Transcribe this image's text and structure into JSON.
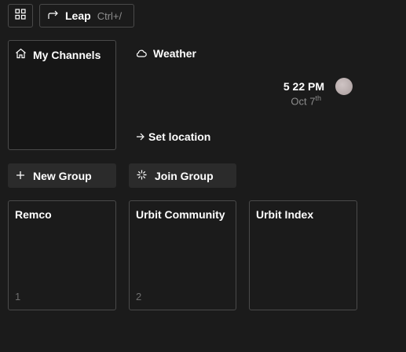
{
  "top_bar": {
    "grid_icon": "grid-icon",
    "leap": {
      "label": "Leap",
      "shortcut": "Ctrl+/",
      "icon": "redirect-arrow-icon"
    }
  },
  "channels_tile": {
    "title": "My Channels",
    "icon": "home-icon"
  },
  "weather": {
    "title": "Weather",
    "icon": "cloud-icon",
    "set_location": "Set location",
    "set_location_icon": "arrow-right-icon",
    "time": "5 22 PM",
    "date": "Oct 7",
    "date_suffix": "th",
    "moon_icon": "moon-icon"
  },
  "actions": {
    "new_group": {
      "label": "New Group",
      "icon": "plus-icon"
    },
    "join_group": {
      "label": "Join Group",
      "icon": "sparkle-icon"
    }
  },
  "groups": [
    {
      "name": "Remco",
      "count": "1"
    },
    {
      "name": "Urbit Community",
      "count": "2"
    },
    {
      "name": "Urbit Index",
      "count": ""
    }
  ],
  "colors": {
    "background": "#1b1b1b",
    "border": "#4a4a4a",
    "button_bg": "#2b2b2b",
    "muted_text": "#8e8e8e"
  }
}
